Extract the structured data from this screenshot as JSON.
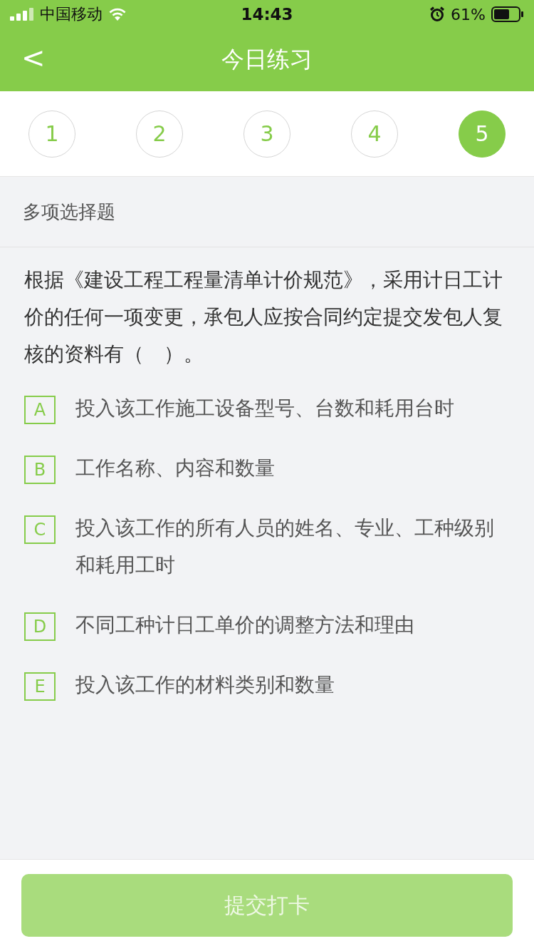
{
  "status_bar": {
    "carrier": "中国移动",
    "time": "14:43",
    "battery": "61%"
  },
  "header": {
    "back": "<",
    "title": "今日练习"
  },
  "steps": [
    {
      "label": "1",
      "selected": false
    },
    {
      "label": "2",
      "selected": false
    },
    {
      "label": "3",
      "selected": false
    },
    {
      "label": "4",
      "selected": false
    },
    {
      "label": "5",
      "selected": true
    }
  ],
  "question_type": "多项选择题",
  "question": "根据《建设工程工程量清单计价规范》，采用计日工计价的任何一项变更，承包人应按合同约定提交发包人复核的资料有（　）。",
  "options": [
    {
      "letter": "A",
      "text": "投入该工作施工设备型号、台数和耗用台时",
      "selected": false
    },
    {
      "letter": "B",
      "text": "工作名称、内容和数量",
      "selected": false
    },
    {
      "letter": "C",
      "text": "投入该工作的所有人员的姓名、专业、工种级别和耗用工时",
      "selected": false
    },
    {
      "letter": "D",
      "text": "不同工种计日工单价的调整方法和理由",
      "selected": false
    },
    {
      "letter": "E",
      "text": "投入该工作的材料类别和数量",
      "selected": false
    }
  ],
  "submit": {
    "label": "提交打卡",
    "disabled": true
  }
}
